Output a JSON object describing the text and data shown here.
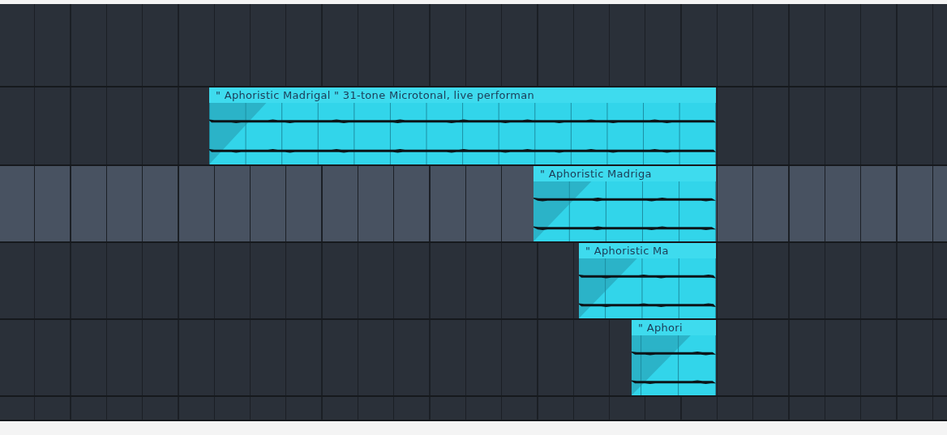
{
  "tracks": [
    {
      "selected": false
    },
    {
      "selected": false,
      "clips": [
        {
          "title": "\" Aphoristic Madrigal \"  31-tone Microtonal, live performan"
        }
      ]
    },
    {
      "selected": true,
      "clips": [
        {
          "title": "\" Aphoristic Madriga"
        }
      ]
    },
    {
      "selected": false,
      "clips": [
        {
          "title": "\" Aphoristic Ma"
        }
      ]
    },
    {
      "selected": false,
      "clips": [
        {
          "title": "\" Aphori"
        }
      ]
    },
    {
      "selected": false
    }
  ]
}
